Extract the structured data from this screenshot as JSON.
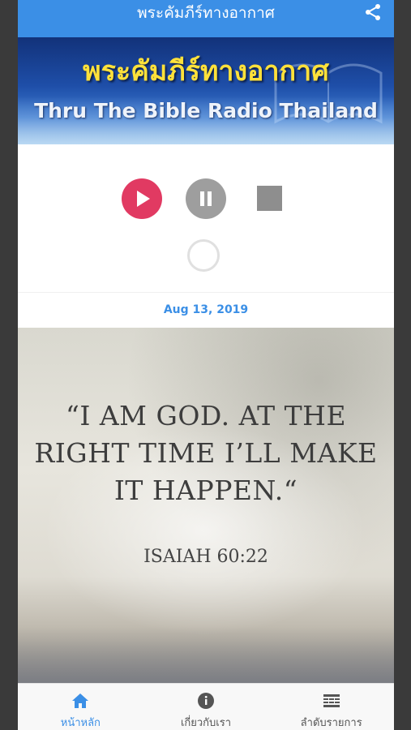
{
  "appbar": {
    "title": "พระคัมภีร์ทางอากาศ",
    "share_icon": "share-icon"
  },
  "banner": {
    "thai_title": "พระคัมภีร์ทางอากาศ",
    "english_title": "Thru The Bible Radio Thailand"
  },
  "player": {
    "play_icon": "play-icon",
    "pause_icon": "pause-icon",
    "stop_icon": "stop-icon"
  },
  "episode": {
    "date": "Aug 13, 2019"
  },
  "verse": {
    "quote": "“I AM GOD. AT THE RIGHT TIME I’LL MAKE IT HAPPEN.“",
    "reference": "ISAIAH 60:22"
  },
  "tabs": [
    {
      "label": "หน้าหลัก",
      "icon": "home-icon",
      "active": true
    },
    {
      "label": "เกี่ยวกับเรา",
      "icon": "info-icon",
      "active": false
    },
    {
      "label": "ลำดับรายการ",
      "icon": "schedule-list-icon",
      "active": false
    }
  ],
  "colors": {
    "primary": "#3b8fe6",
    "play": "#e13a62",
    "pause": "#9e9e9e",
    "stop": "#8e8e8e"
  }
}
